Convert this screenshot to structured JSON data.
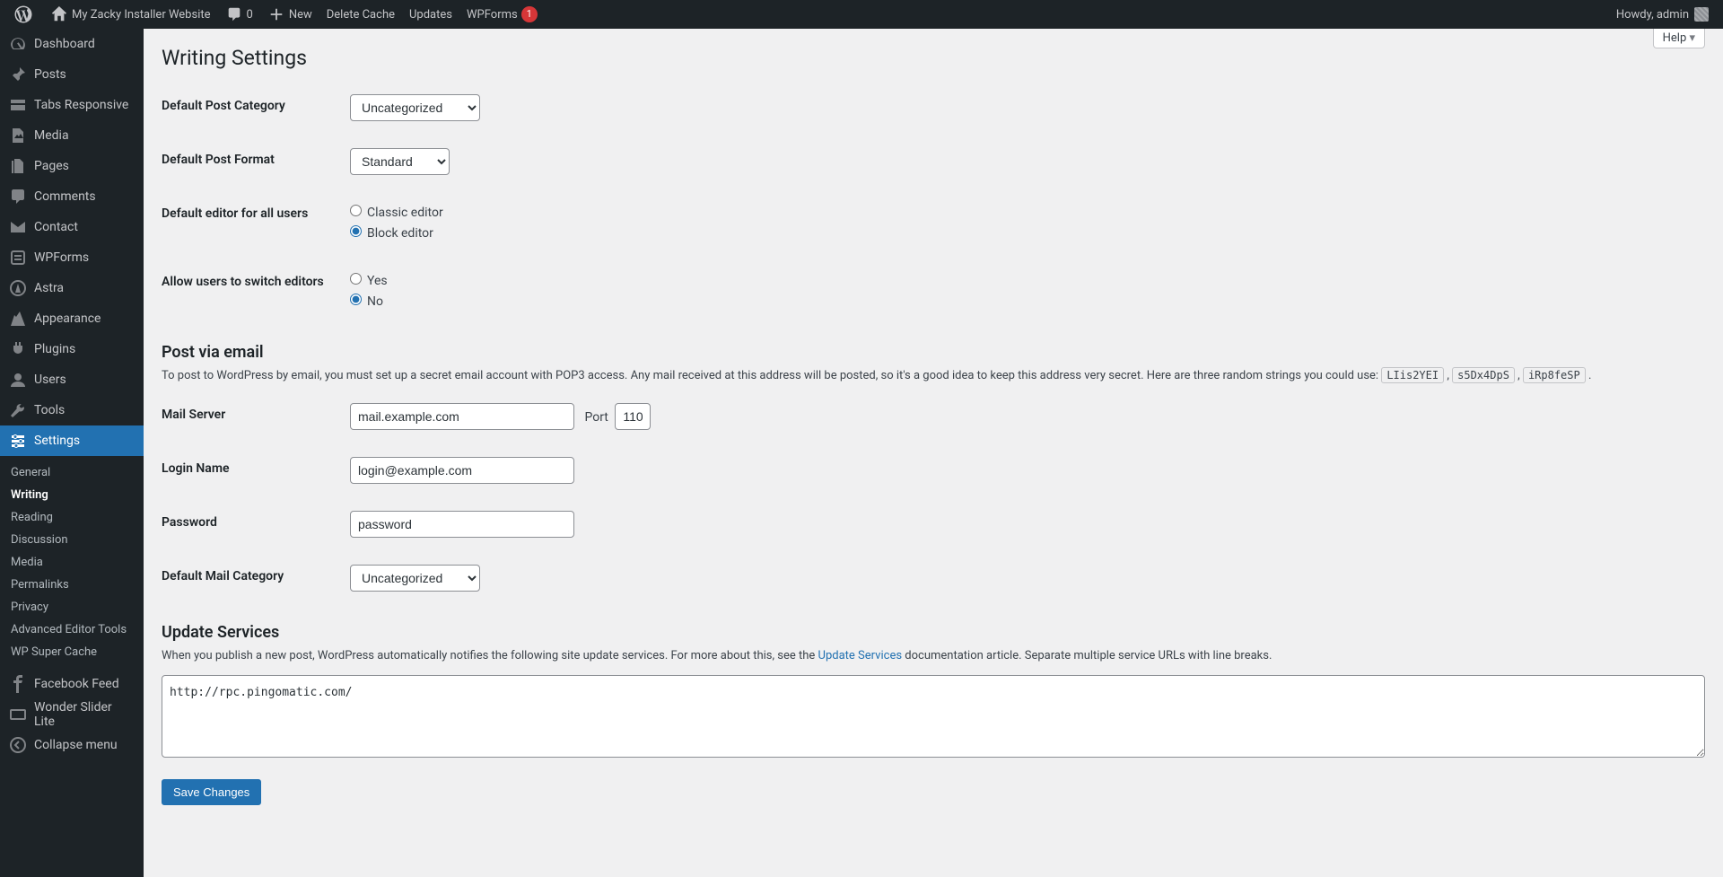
{
  "adminbar": {
    "site_name": "My Zacky Installer Website",
    "comments_count": "0",
    "new_label": "New",
    "delete_cache": "Delete Cache",
    "updates": "Updates",
    "wpforms": "WPForms",
    "wpforms_count": "1",
    "howdy": "Howdy, admin"
  },
  "menu": {
    "dashboard": "Dashboard",
    "posts": "Posts",
    "tabs_responsive": "Tabs Responsive",
    "media": "Media",
    "pages": "Pages",
    "comments": "Comments",
    "contact": "Contact",
    "wpforms": "WPForms",
    "astra": "Astra",
    "appearance": "Appearance",
    "plugins": "Plugins",
    "users": "Users",
    "tools": "Tools",
    "settings": "Settings",
    "facebook_feed": "Facebook Feed",
    "wonder_slider": "Wonder Slider Lite",
    "collapse": "Collapse menu",
    "sub": {
      "general": "General",
      "writing": "Writing",
      "reading": "Reading",
      "discussion": "Discussion",
      "media": "Media",
      "permalinks": "Permalinks",
      "privacy": "Privacy",
      "adv_editor": "Advanced Editor Tools",
      "wp_super_cache": "WP Super Cache"
    }
  },
  "screen": {
    "help": "Help"
  },
  "page": {
    "title": "Writing Settings",
    "labels": {
      "default_post_category": "Default Post Category",
      "default_post_format": "Default Post Format",
      "default_editor": "Default editor for all users",
      "allow_switch": "Allow users to switch editors",
      "mail_server": "Mail Server",
      "port": "Port",
      "login_name": "Login Name",
      "password": "Password",
      "default_mail_category": "Default Mail Category"
    },
    "values": {
      "default_post_category": "Uncategorized",
      "default_post_format": "Standard",
      "classic_editor": "Classic editor",
      "block_editor": "Block editor",
      "yes": "Yes",
      "no": "No",
      "mail_server": "mail.example.com",
      "port": "110",
      "login_name": "login@example.com",
      "password": "password",
      "default_mail_category": "Uncategorized",
      "ping_sites": "http://rpc.pingomatic.com/"
    },
    "post_via_email": {
      "heading": "Post via email",
      "desc_1": "To post to WordPress by email, you must set up a secret email account with POP3 access. Any mail received at this address will be posted, so it's a good idea to keep this address very secret. Here are three random strings you could use: ",
      "rand1": "LIis2YEI",
      "rand2": "s5Dx4DpS",
      "rand3": "iRp8feSP"
    },
    "update_services": {
      "heading": "Update Services",
      "desc_1": "When you publish a new post, WordPress automatically notifies the following site update services. For more about this, see the ",
      "link": "Update Services",
      "desc_2": " documentation article. Separate multiple service URLs with line breaks."
    },
    "save_button": "Save Changes"
  }
}
